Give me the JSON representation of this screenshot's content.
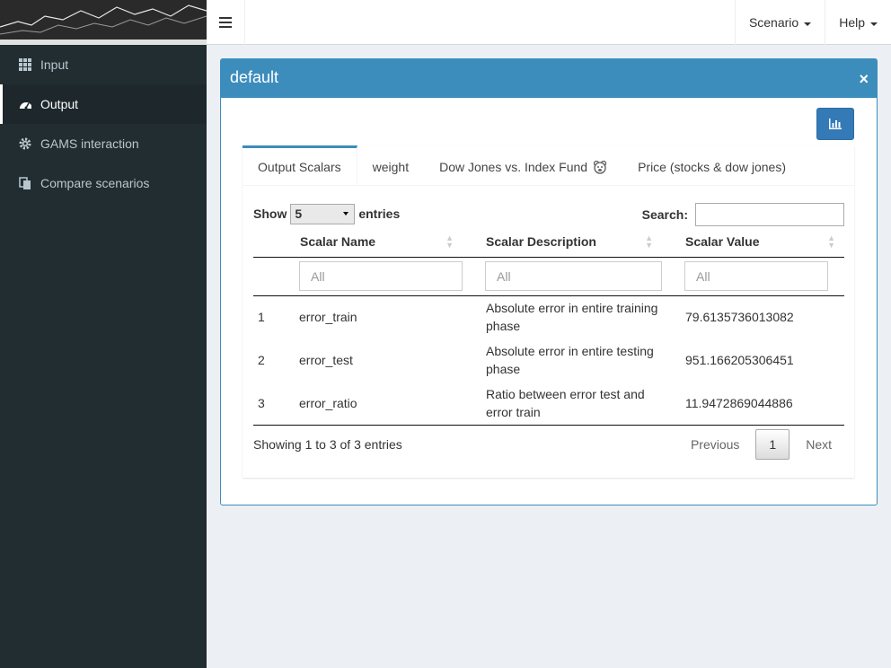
{
  "header": {
    "menu_items": [
      {
        "label": "Scenario"
      },
      {
        "label": "Help"
      }
    ]
  },
  "sidebar": {
    "items": [
      {
        "label": "Input",
        "icon": "th-icon"
      },
      {
        "label": "Output",
        "icon": "dashboard-icon",
        "active": true
      },
      {
        "label": "GAMS interaction",
        "icon": "gear-icon"
      },
      {
        "label": "Compare scenarios",
        "icon": "copy-icon"
      }
    ]
  },
  "box": {
    "title": "default",
    "close": "×"
  },
  "tabs": [
    {
      "label": "Output Scalars",
      "active": true
    },
    {
      "label": "weight"
    },
    {
      "label": "Dow Jones vs. Index Fund"
    },
    {
      "label": "Price (stocks & dow jones)"
    }
  ],
  "table": {
    "show_label": "Show",
    "entries_label": "entries",
    "page_length": "5",
    "search_label": "Search:",
    "columns": [
      "Scalar Name",
      "Scalar Description",
      "Scalar Value"
    ],
    "filter_placeholder": "All",
    "rows": [
      {
        "idx": "1",
        "name": "error_train",
        "desc": "Absolute error in entire training phase",
        "value": "79.6135736013082"
      },
      {
        "idx": "2",
        "name": "error_test",
        "desc": "Absolute error in entire testing phase",
        "value": "951.166205306451"
      },
      {
        "idx": "3",
        "name": "error_ratio",
        "desc": "Ratio between error test and error train",
        "value": "11.9472869044886"
      }
    ],
    "info": "Showing 1 to 3 of 3 entries",
    "pagination": {
      "previous": "Previous",
      "current": "1",
      "next": "Next"
    }
  },
  "colors": {
    "accent": "#3c8dbc",
    "sidebar_bg": "#222d32",
    "button_primary": "#337ab7"
  }
}
